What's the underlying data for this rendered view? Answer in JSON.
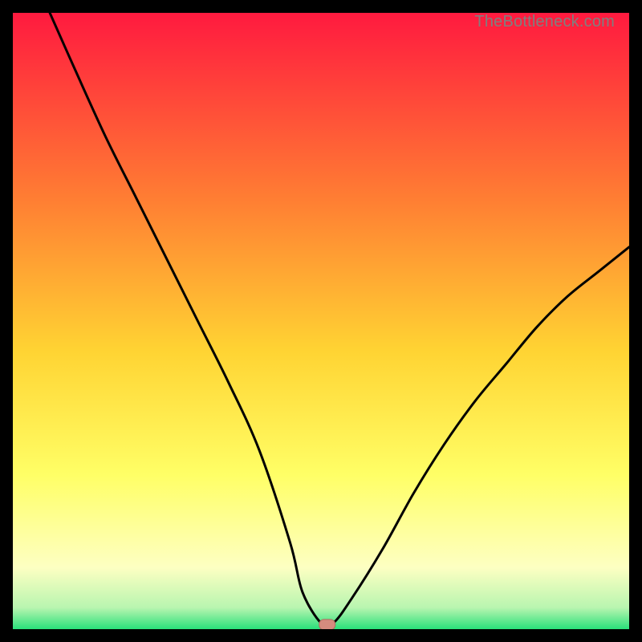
{
  "watermark": "TheBottleneck.com",
  "colors": {
    "grad_top": "#ff1a3f",
    "grad_mid_upper": "#ff7d33",
    "grad_mid": "#ffd433",
    "grad_mid_lower": "#ffff66",
    "grad_pale": "#fdffc2",
    "grad_green": "#29e07a",
    "curve": "#000000",
    "marker_fill": "#d58b7e",
    "marker_stroke": "#b06b5f",
    "frame": "#000000"
  },
  "chart_data": {
    "type": "line",
    "title": "",
    "xlabel": "",
    "ylabel": "",
    "xlim": [
      0,
      100
    ],
    "ylim": [
      0,
      100
    ],
    "series": [
      {
        "name": "bottleneck-curve",
        "x": [
          6,
          10,
          15,
          20,
          25,
          30,
          35,
          40,
          45,
          47,
          50,
          52,
          55,
          60,
          65,
          70,
          75,
          80,
          85,
          90,
          95,
          100
        ],
        "y": [
          100,
          91,
          80,
          70,
          60,
          50,
          40,
          29,
          14,
          6,
          1,
          1,
          5,
          13,
          22,
          30,
          37,
          43,
          49,
          54,
          58,
          62
        ]
      }
    ],
    "marker": {
      "x": 51,
      "y": 0.8
    },
    "gradient_stops": [
      {
        "pos": 0.0,
        "color": "#ff1a3f"
      },
      {
        "pos": 0.3,
        "color": "#ff7d33"
      },
      {
        "pos": 0.55,
        "color": "#ffd433"
      },
      {
        "pos": 0.75,
        "color": "#ffff66"
      },
      {
        "pos": 0.9,
        "color": "#fdffc2"
      },
      {
        "pos": 0.965,
        "color": "#b9f5b0"
      },
      {
        "pos": 1.0,
        "color": "#29e07a"
      }
    ]
  }
}
